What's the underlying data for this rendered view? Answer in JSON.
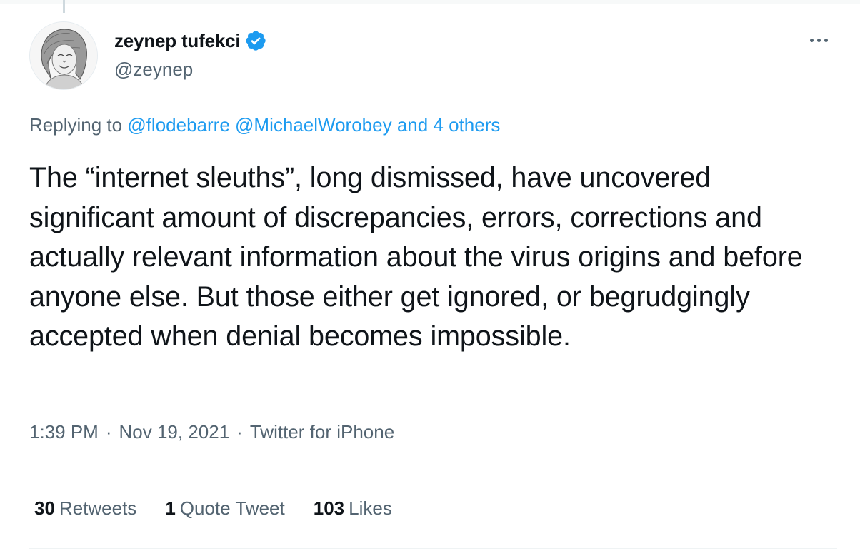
{
  "author": {
    "display_name": "zeynep tufekci",
    "handle": "@zeynep",
    "verified": true,
    "avatar_icon": "sketch-portrait-avatar"
  },
  "reply_context": {
    "prefix": "Replying to",
    "mentions": [
      "@flodebarre",
      "@MichaelWorobey"
    ],
    "others": "and 4 others"
  },
  "tweet": {
    "text": "The “internet sleuths”, long dismissed, have uncovered significant amount of discrepancies, errors, corrections and actually relevant information about the virus origins and before anyone else. But those either get ignored, or begrudgingly accepted when denial becomes impossible."
  },
  "meta": {
    "time": "1:39 PM",
    "date": "Nov 19, 2021",
    "source": "Twitter for iPhone",
    "separator": "·"
  },
  "stats": {
    "retweets_count": "30",
    "retweets_label": "Retweets",
    "quotes_count": "1",
    "quotes_label": "Quote Tweet",
    "likes_count": "103",
    "likes_label": "Likes"
  },
  "colors": {
    "link": "#1d9bf0",
    "secondary_text": "#536471",
    "primary_text": "#0f1419",
    "divider": "#eff3f4"
  }
}
